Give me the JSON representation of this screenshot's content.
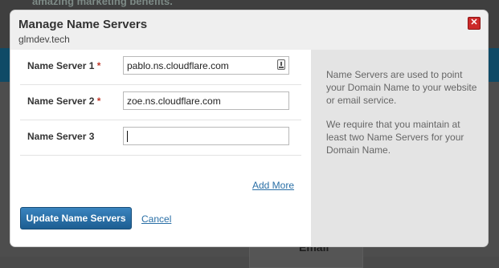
{
  "background": {
    "teaser_text": "amazing marketing benefits.",
    "email_label": "Email"
  },
  "modal": {
    "title": "Manage Name Servers",
    "domain": "glmdev.tech",
    "close_icon": "close-icon"
  },
  "form": {
    "rows": [
      {
        "label": "Name Server 1",
        "required_mark": "*",
        "value": "pablo.ns.cloudflare.com"
      },
      {
        "label": "Name Server 2",
        "required_mark": "*",
        "value": "zoe.ns.cloudflare.com"
      },
      {
        "label": "Name Server 3",
        "required_mark": "",
        "value": ""
      }
    ],
    "add_more_label": "Add More",
    "submit_label": "Update Name Servers",
    "cancel_label": "Cancel"
  },
  "info": {
    "paragraphs": [
      "Name Servers are used to point your Domain Name to your website or email service.",
      "We require that you maintain at least two Name Servers for your Domain Name."
    ]
  },
  "colors": {
    "accent": "#2a6fa6",
    "button": "#1d5e92",
    "required": "#c0392b",
    "close": "#cc2a2a"
  }
}
